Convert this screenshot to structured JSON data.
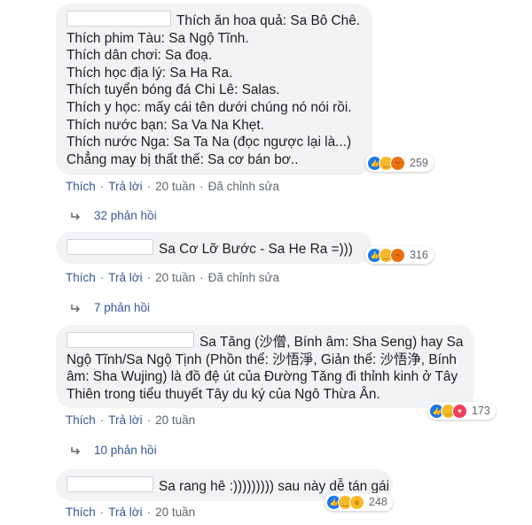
{
  "comments": [
    {
      "lines": [
        "Thích ăn hoa quả: Sa Bô Chê.",
        "Thích phim Tàu: Sa Ngộ Tĩnh.",
        "Thích dân chơi: Sa đoạ.",
        "Thích học địa lý: Sa Ha Ra.",
        "Thích tuyển bóng đá Chi Lê: Salas.",
        "Thích y học: mấy cái tên dưới chúng nó nói rồi.",
        "Thích nước bạn: Sa Va Na Khẹt.",
        "Thích nước Nga: Sa Ta Na (đọc ngược lại là...)",
        "Chẳng may bị thất thế: Sa cơ bán bơ.."
      ],
      "reaction_count": "259",
      "reactions": [
        "like-icon",
        "haha-icon",
        "angry-icon"
      ],
      "actions": {
        "like": "Thích",
        "reply": "Trả lời",
        "time": "20 tuần",
        "edited": "Đã chỉnh sửa"
      },
      "replies": "32 phản hồi"
    },
    {
      "lines": [
        "Sa Cơ Lỡ Bước - Sa He Ra =)))"
      ],
      "reaction_count": "316",
      "reactions": [
        "like-icon",
        "haha-icon",
        "angry-icon"
      ],
      "actions": {
        "like": "Thích",
        "reply": "Trả lời",
        "time": "20 tuần",
        "edited": "Đã chỉnh sửa"
      },
      "replies": "7 phản hồi"
    },
    {
      "lines": [
        "Sa Tăng (沙僧, Bính âm: Sha Seng) hay Sa",
        "Ngộ Tĩnh/Sa Ngộ Tịnh (Phồn thể: 沙悟淨, Giản thể: 沙悟浄, Bính",
        "âm: Sha Wujing) là đồ đệ út của Đường Tăng đi thỉnh kinh ở Tây",
        "Thiên trong tiểu thuyết Tây du ký của Ngô Thừa Ân."
      ],
      "reaction_count": "173",
      "reactions": [
        "like-icon",
        "haha-icon",
        "love-icon"
      ],
      "actions": {
        "like": "Thích",
        "reply": "Trả lời",
        "time": "20 tuần"
      },
      "replies": "10 phản hồi"
    },
    {
      "lines": [
        "Sa rang hê :))))))))) sau này dễ tán gái"
      ],
      "reaction_count": "248",
      "reactions": [
        "like-icon",
        "haha-icon",
        "wow-icon"
      ],
      "actions": {
        "like": "Thích",
        "reply": "Trả lời",
        "time": "20 tuần"
      }
    }
  ],
  "colors": {
    "bubble": "#f2f3f5",
    "link": "#385898",
    "meta": "#606770",
    "like": "#1877f2",
    "haha": "#f7b928",
    "angry": "#e9710f",
    "love": "#f33e58"
  }
}
